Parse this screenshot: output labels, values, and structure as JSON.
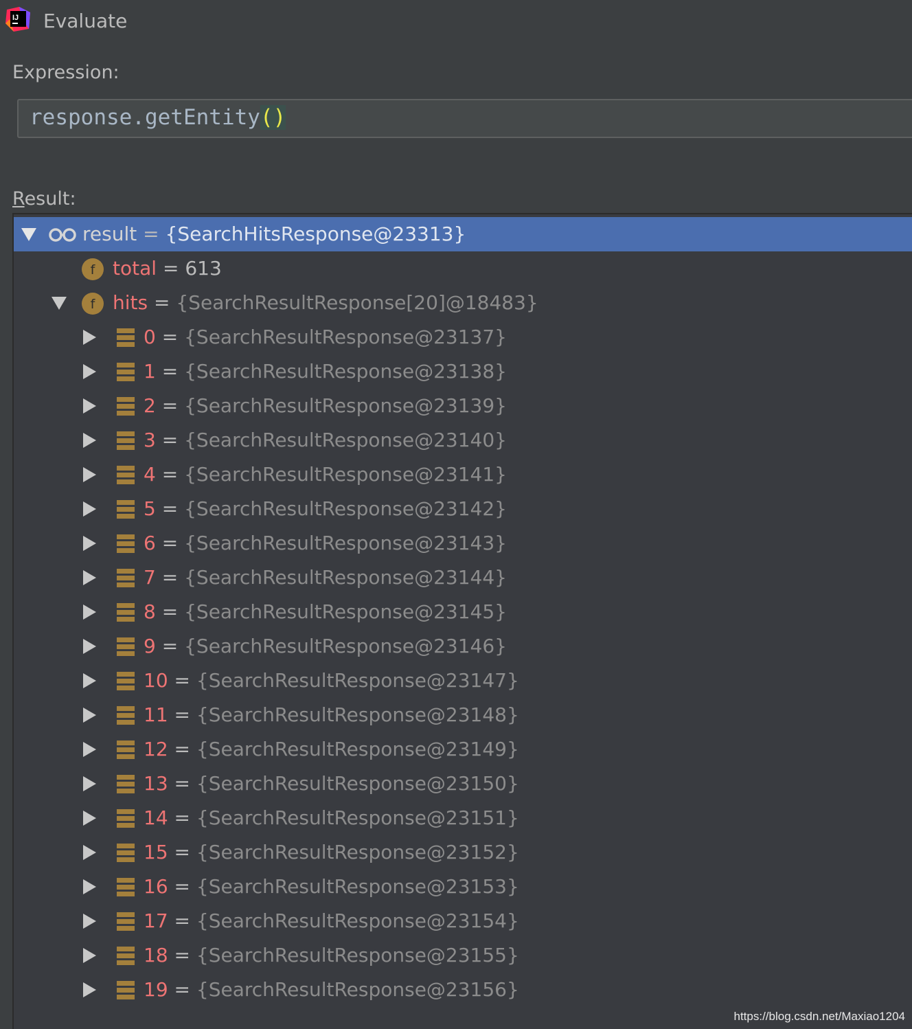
{
  "window": {
    "title": "Evaluate",
    "logo_icon": "intellij-idea-logo-icon"
  },
  "expression": {
    "label": "Expression:",
    "method": "response.getEntity",
    "parens": "()"
  },
  "result": {
    "label_mnemonic": "R",
    "label_rest": "esult:"
  },
  "tree": {
    "root": {
      "name": "result",
      "eq": "=",
      "value": "{SearchHitsResponse@23313}",
      "icon": "watch-glasses-icon",
      "expanded": true
    },
    "fields": [
      {
        "name": "total",
        "eq": "=",
        "value": "613",
        "icon": "field-icon",
        "expandable": false
      },
      {
        "name": "hits",
        "eq": "=",
        "value": "{SearchResultResponse[20]@18483}",
        "icon": "field-icon",
        "expandable": true,
        "expanded": true
      }
    ],
    "hits": [
      {
        "index": "0",
        "value": "{SearchResultResponse@23137}"
      },
      {
        "index": "1",
        "value": "{SearchResultResponse@23138}"
      },
      {
        "index": "2",
        "value": "{SearchResultResponse@23139}"
      },
      {
        "index": "3",
        "value": "{SearchResultResponse@23140}"
      },
      {
        "index": "4",
        "value": "{SearchResultResponse@23141}"
      },
      {
        "index": "5",
        "value": "{SearchResultResponse@23142}"
      },
      {
        "index": "6",
        "value": "{SearchResultResponse@23143}"
      },
      {
        "index": "7",
        "value": "{SearchResultResponse@23144}"
      },
      {
        "index": "8",
        "value": "{SearchResultResponse@23145}"
      },
      {
        "index": "9",
        "value": "{SearchResultResponse@23146}"
      },
      {
        "index": "10",
        "value": "{SearchResultResponse@23147}"
      },
      {
        "index": "11",
        "value": "{SearchResultResponse@23148}"
      },
      {
        "index": "12",
        "value": "{SearchResultResponse@23149}"
      },
      {
        "index": "13",
        "value": "{SearchResultResponse@23150}"
      },
      {
        "index": "14",
        "value": "{SearchResultResponse@23151}"
      },
      {
        "index": "15",
        "value": "{SearchResultResponse@23152}"
      },
      {
        "index": "16",
        "value": "{SearchResultResponse@23153}"
      },
      {
        "index": "17",
        "value": "{SearchResultResponse@23154}"
      },
      {
        "index": "18",
        "value": "{SearchResultResponse@23155}"
      },
      {
        "index": "19",
        "value": "{SearchResultResponse@23156}"
      }
    ],
    "hit_icon": "array-element-icon",
    "eq": "="
  },
  "watermark": "https://blog.csdn.net/Maxiao1204",
  "colors": {
    "background": "#3c3f41",
    "selection": "#4b6eaf",
    "field_name": "#ee7474",
    "icon_gold": "#a4803c"
  }
}
